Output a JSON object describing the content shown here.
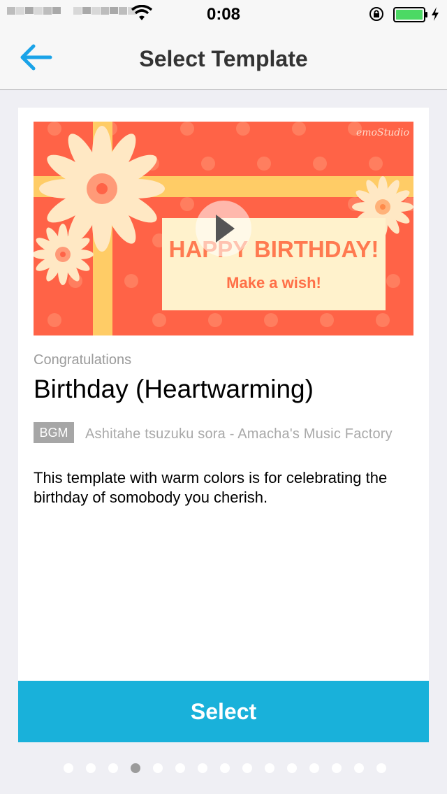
{
  "status_bar": {
    "time": "0:08",
    "icons": [
      "carrier-signal",
      "wifi-icon",
      "orientation-lock-icon",
      "battery-icon",
      "charging-bolt-icon"
    ],
    "battery_color": "#4cd964"
  },
  "nav": {
    "title": "Select Template",
    "back_icon": "back-arrow-icon",
    "accent_color": "#1aa3e8"
  },
  "template": {
    "category": "Congratulations",
    "title": "Birthday (Heartwarming)",
    "bgm_label": "BGM",
    "bgm_track": "Ashitahe tsuzuku sora - Amacha's Music Factory",
    "description": "This template with warm colors is for celebrating the birthday of somobody you cherish.",
    "preview": {
      "watermark": "emoStudio",
      "headline": "HAPPY BIRTHDAY!",
      "subline": "Make a wish!",
      "play_icon": "play-icon",
      "background_color": "#ff6347"
    }
  },
  "select_button": {
    "label": "Select",
    "color": "#19b1da"
  },
  "pager": {
    "total": 15,
    "current": 4
  }
}
